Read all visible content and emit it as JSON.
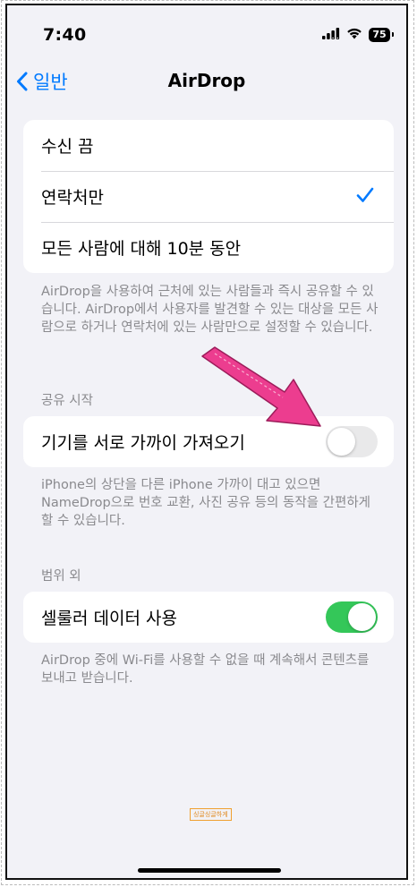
{
  "status_bar": {
    "time": "7:40",
    "battery": "75"
  },
  "nav": {
    "back_label": "일반",
    "title": "AirDrop"
  },
  "receive_options": {
    "items": [
      {
        "label": "수신 끔",
        "selected": false
      },
      {
        "label": "연락처만",
        "selected": true
      },
      {
        "label": "모든 사람에 대해 10분 동안",
        "selected": false
      }
    ],
    "footer": "AirDrop을 사용하여 근처에 있는 사람들과 즉시 공유할 수 있습니다. AirDrop에서 사용자를 발견할 수 있는 대상을 모든 사람으로 하거나 연락처에 있는 사람만으로 설정할 수 있습니다."
  },
  "start_sharing": {
    "header": "공유 시작",
    "toggle_label": "기기를 서로 가까이 가져오기",
    "toggle_on": false,
    "footer": "iPhone의 상단을 다른 iPhone 가까이 대고 있으면 NameDrop으로 번호 교환, 사진 공유 등의 동작을 간편하게 할 수 있습니다."
  },
  "out_of_range": {
    "header": "범위 외",
    "toggle_label": "셀룰러 데이터 사용",
    "toggle_on": true,
    "footer": "AirDrop 중에 Wi-Fi를 사용할 수 없을 때 계속해서 콘텐츠를 보내고 받습니다."
  },
  "watermark": "싱글싱글하게",
  "colors": {
    "accent": "#007aff",
    "toggle_on": "#34c759",
    "toggle_off": "#e9e9ea",
    "background": "#f2f2f7",
    "arrow": "#ec3d8f"
  },
  "icons": [
    "chevron-left-icon",
    "signal-icon",
    "wifi-icon",
    "battery-icon",
    "checkmark-icon",
    "arrow-annotation"
  ]
}
